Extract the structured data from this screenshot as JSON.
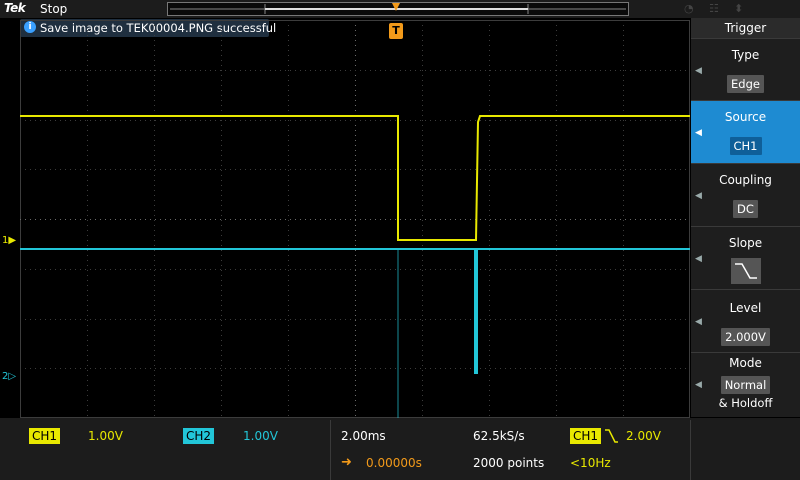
{
  "topbar": {
    "logo": "Tek",
    "run_state": "Stop"
  },
  "message": {
    "icon": "info-icon",
    "text": "Save image to TEK00004.PNG successful"
  },
  "trigger_marker": "T",
  "channel_markers": {
    "ch1": "1",
    "ch2": "2"
  },
  "colors": {
    "ch1": "#e8e800",
    "ch2": "#22c6d8",
    "trigger": "#f29a1a",
    "accent": "#1e8bd2"
  },
  "trigger_menu": {
    "title": "Trigger",
    "items": [
      {
        "label": "Type",
        "value": "Edge"
      },
      {
        "label": "Source",
        "value": "CH1"
      },
      {
        "label": "Coupling",
        "value": "DC"
      },
      {
        "label": "Slope",
        "value": "falling-edge-icon"
      },
      {
        "label": "Level",
        "value": "2.000V"
      },
      {
        "label": "Mode",
        "value": "Normal",
        "value2": "& Holdoff"
      }
    ]
  },
  "bottom": {
    "ch1_label": "CH1",
    "ch1_scale": "1.00V",
    "ch2_label": "CH2",
    "ch2_scale": "1.00V",
    "time_scale": "2.00ms",
    "sample_rate": "62.5kS/s",
    "delay": "0.00000s",
    "record_length": "2000 points",
    "trig_source": "CH1",
    "trig_level": "2.00V",
    "trig_freq": "<10Hz"
  }
}
